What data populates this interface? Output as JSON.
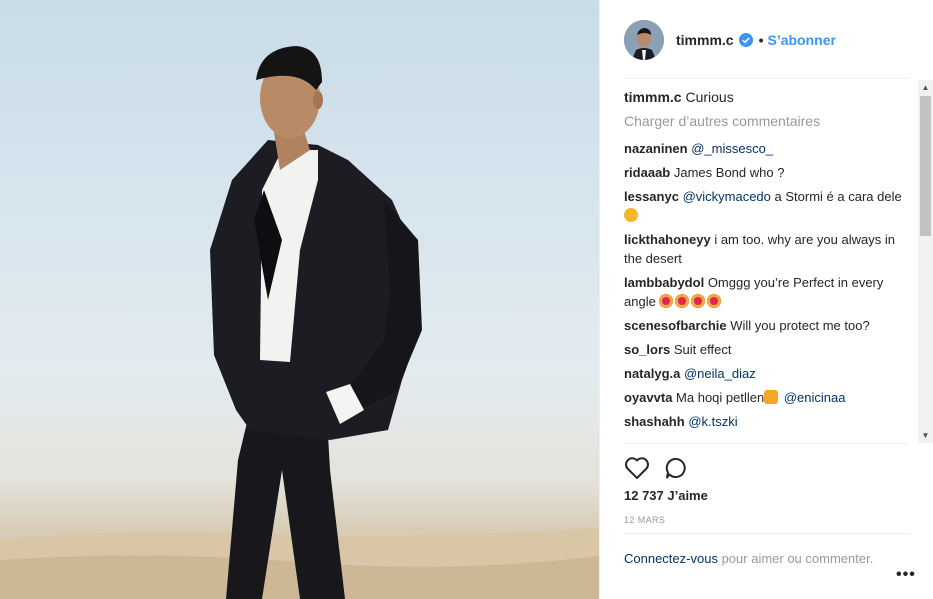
{
  "header": {
    "username": "timmm.c",
    "separator": "•",
    "follow_label": "S’abonner"
  },
  "caption": {
    "username": "timmm.c",
    "text": "Curious"
  },
  "load_more_label": "Charger d’autres commentaires",
  "comments": [
    {
      "user": "nazaninen",
      "text": "",
      "mention": "@_missesco_",
      "after": ""
    },
    {
      "user": "ridaaab",
      "text": "James Bond who ?",
      "mention": "",
      "after": ""
    },
    {
      "user": "lessanyc",
      "text": "",
      "mention": "@vickymacedo",
      "after": "a Stormi é a cara dele"
    },
    {
      "user": "lickthahoneyy",
      "text": "i am too. why are you always in the desert",
      "mention": "",
      "after": ""
    },
    {
      "user": "lambbabydol",
      "text": "Omggg you’re Perfect in every angle",
      "mention": "",
      "after": ""
    },
    {
      "user": "scenesofbarchie",
      "text": "Will you protect me too?",
      "mention": "",
      "after": ""
    },
    {
      "user": "so_lors",
      "text": "Suit effect",
      "mention": "",
      "after": ""
    },
    {
      "user": "natalyg.a",
      "text": "",
      "mention": "@neila_diaz",
      "after": ""
    },
    {
      "user": "oyavvta",
      "text": "Ma hoqi petllen",
      "mention": "@enicinaa",
      "after": ""
    },
    {
      "user": "shashahh",
      "text": "",
      "mention": "@k.tszki",
      "after": ""
    }
  ],
  "icons": {
    "like": "heart-icon",
    "comment": "comment-icon",
    "verified": "verified-badge-icon",
    "more": "more-options-icon"
  },
  "likes_label": "12 737 J’aime",
  "date_label": "12 MARS",
  "login": {
    "link": "Connectez-vous",
    "text": "pour aimer ou commenter."
  },
  "more_label": "•••",
  "colors": {
    "link": "#3897f0",
    "mention": "#003569",
    "muted": "#999999"
  }
}
